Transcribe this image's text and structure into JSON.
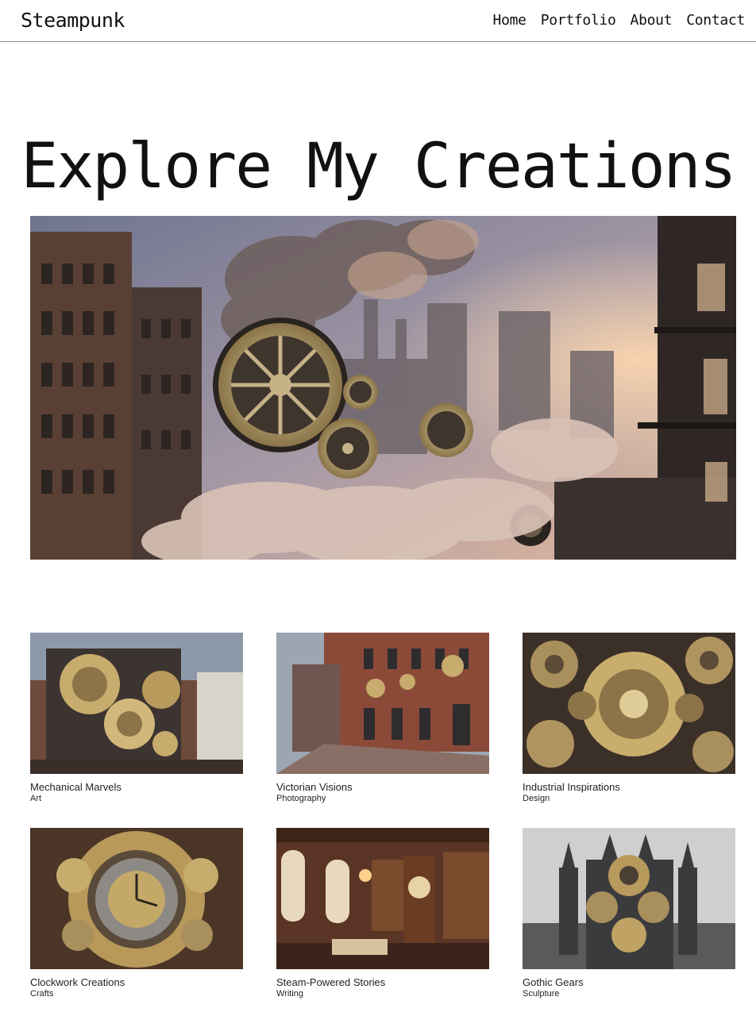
{
  "header": {
    "brand": "Steampunk",
    "nav": [
      "Home",
      "Portfolio",
      "About",
      "Contact"
    ]
  },
  "hero": {
    "title": "Explore My Creations",
    "image_icon": "steampunk-city-gears-image"
  },
  "portfolio": [
    {
      "title": "Mechanical Marvels",
      "category": "Art"
    },
    {
      "title": "Victorian Visions",
      "category": "Photography"
    },
    {
      "title": "Industrial Inspirations",
      "category": "Design"
    },
    {
      "title": "Clockwork Creations",
      "category": "Crafts"
    },
    {
      "title": "Steam-Powered Stories",
      "category": "Writing"
    },
    {
      "title": "Gothic Gears",
      "category": "Sculpture"
    }
  ],
  "colors": {
    "brass": "#b79a5c",
    "brick": "#7a3f2c",
    "smoke": "#c9b3a4",
    "sky": "#8d8fa3"
  }
}
